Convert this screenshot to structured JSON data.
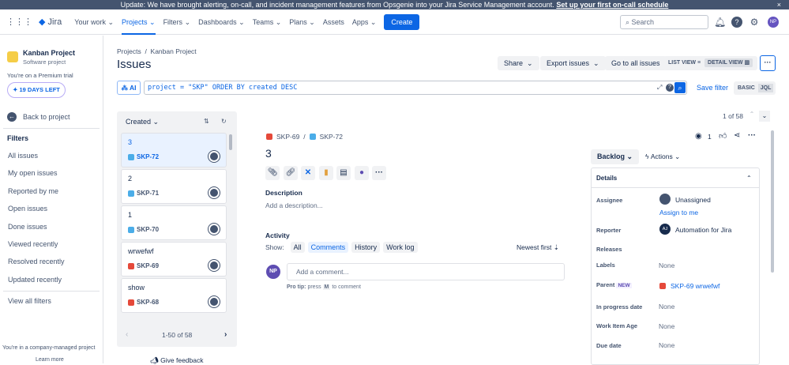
{
  "banner": {
    "text": "Update: We have brought alerting, on-call, and incident management features from Opsgenie into your Jira Service Management account.",
    "link": "Set up your first on-call schedule",
    "close": "×"
  },
  "nav": {
    "logo": "Jira",
    "items": [
      "Your work",
      "Projects",
      "Filters",
      "Dashboards",
      "Teams",
      "Plans",
      "Assets",
      "Apps"
    ],
    "create": "Create",
    "search_placeholder": "Search",
    "avatar": "NP"
  },
  "sidebar": {
    "project_name": "Kanban Project",
    "project_type": "Software project",
    "trial": "You're on a Premium trial",
    "days_left": "19 DAYS LEFT",
    "back": "Back to project",
    "filters_heading": "Filters",
    "filters": [
      "All issues",
      "My open issues",
      "Reported by me",
      "Open issues",
      "Done issues",
      "Viewed recently",
      "Resolved recently",
      "Updated recently"
    ],
    "view_all": "View all filters",
    "footer": "You're in a company-managed project",
    "learn_more": "Learn more"
  },
  "header": {
    "breadcrumb": [
      "Projects",
      "Kanban Project"
    ],
    "title": "Issues",
    "share": "Share",
    "export": "Export issues",
    "go_all": "Go to all issues",
    "list_view": "LIST VIEW",
    "detail_view": "DETAIL VIEW"
  },
  "query": {
    "ai": "AI",
    "jql": "project = \"SKP\" ORDER BY created DESC",
    "save_filter": "Save filter",
    "basic": "BASIC",
    "jql_mode": "JQL"
  },
  "list": {
    "sort": "Created",
    "pagination": "1-50 of 58",
    "feedback": "Give feedback",
    "items": [
      {
        "title": "3",
        "key": "SKP-72",
        "type": "task"
      },
      {
        "title": "2",
        "key": "SKP-71",
        "type": "task"
      },
      {
        "title": "1",
        "key": "SKP-70",
        "type": "task"
      },
      {
        "title": "wrwefwf",
        "key": "SKP-69",
        "type": "bug"
      },
      {
        "title": "show",
        "key": "SKP-68",
        "type": "bug"
      }
    ]
  },
  "colors": {
    "accent": "#0c66e4",
    "task": "#4bade8",
    "bug": "#e5493a"
  },
  "issue": {
    "counter": "1 of 58",
    "parent_key": "SKP-69",
    "key": "SKP-72",
    "title": "3",
    "watchers": "1",
    "description_label": "Description",
    "description_placeholder": "Add a description...",
    "activity": "Activity",
    "show": "Show:",
    "filters": [
      "All",
      "Comments",
      "History",
      "Work log"
    ],
    "sort": "Newest first",
    "comment_avatar": "NP",
    "comment_placeholder": "Add a comment...",
    "pro_tip": "Pro tip:",
    "pro_tip_press": "press",
    "pro_tip_key": "M",
    "pro_tip_rest": "to comment"
  },
  "details": {
    "status": "Backlog",
    "actions": "Actions",
    "heading": "Details",
    "assignee_label": "Assignee",
    "assignee": "Unassigned",
    "assign_me": "Assign to me",
    "reporter_label": "Reporter",
    "reporter_avatar": "AJ",
    "reporter": "Automation for Jira",
    "releases_label": "Releases",
    "labels_label": "Labels",
    "labels": "None",
    "parent_label": "Parent",
    "parent_badge": "NEW",
    "parent": "SKP-69 wrwefwf",
    "inprogress_label": "In progress date",
    "inprogress": "None",
    "age_label": "Work Item Age",
    "age": "None",
    "due_label": "Due date",
    "due": "None"
  }
}
